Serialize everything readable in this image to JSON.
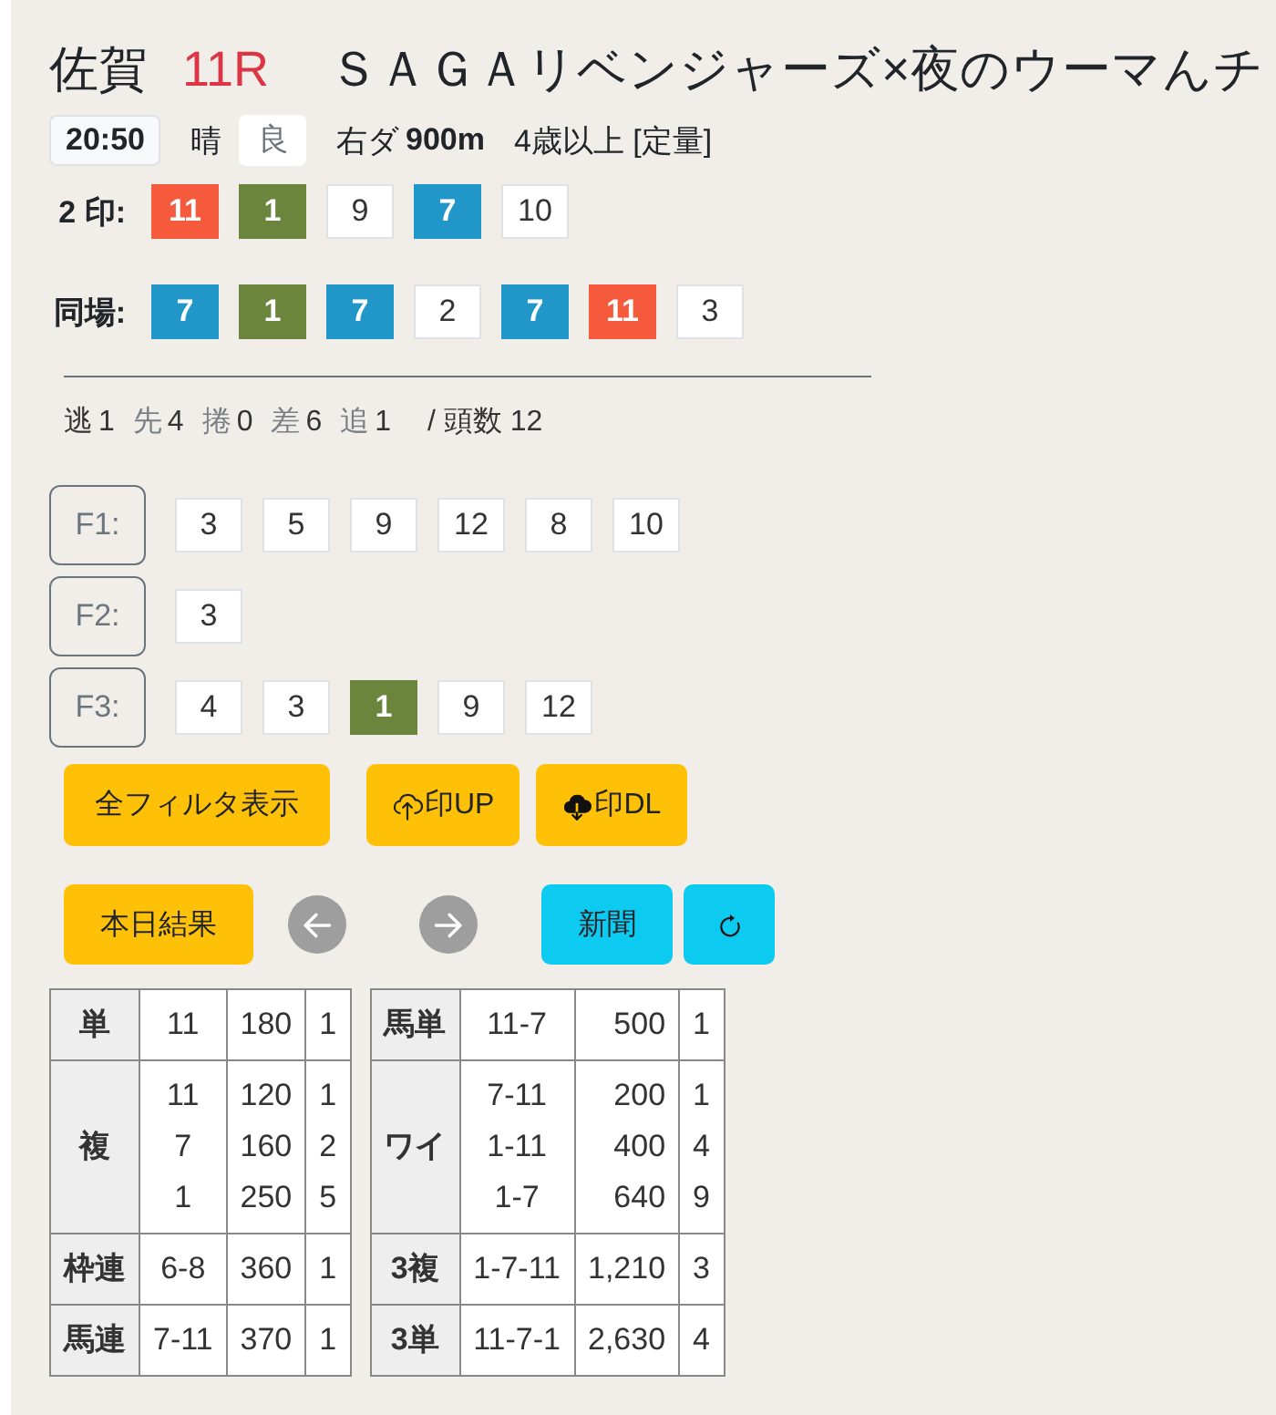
{
  "header": {
    "venue": "佐賀",
    "race_number": "11R",
    "race_name": "ＳＡＧＡリベンジャーズ×夜のウーマんチ"
  },
  "conditions": {
    "post_time": "20:50",
    "weather": "晴",
    "going": "良",
    "course": "右ダ",
    "distance": "900m",
    "race_class": "4歳以上 [定量]"
  },
  "mark_rows": [
    {
      "label": "2 印:",
      "items": [
        {
          "number": "11",
          "color": "#f55a3c"
        },
        {
          "number": "1",
          "color": "#6b853d"
        },
        {
          "number": "9",
          "color": "#ffffff"
        },
        {
          "number": "7",
          "color": "#2196c9"
        },
        {
          "number": "10",
          "color": "#ffffff"
        }
      ]
    },
    {
      "label": "同場:",
      "items": [
        {
          "number": "7",
          "color": "#2196c9"
        },
        {
          "number": "1",
          "color": "#6b853d"
        },
        {
          "number": "7",
          "color": "#2196c9"
        },
        {
          "number": "2",
          "color": "#ffffff"
        },
        {
          "number": "7",
          "color": "#2196c9"
        },
        {
          "number": "11",
          "color": "#f55a3c"
        },
        {
          "number": "3",
          "color": "#ffffff"
        }
      ]
    }
  ],
  "running_styles": {
    "items": [
      {
        "label": "逃",
        "count": "1",
        "active": true
      },
      {
        "label": "先",
        "count": "4",
        "active": false
      },
      {
        "label": "捲",
        "count": "0",
        "active": false
      },
      {
        "label": "差",
        "count": "6",
        "active": false
      },
      {
        "label": "追",
        "count": "1",
        "active": false
      }
    ],
    "field_size": "/ 頭数 12"
  },
  "filters": [
    {
      "label": "F1:",
      "items": [
        {
          "number": "3",
          "color": "#ffffff"
        },
        {
          "number": "5",
          "color": "#ffffff"
        },
        {
          "number": "9",
          "color": "#ffffff"
        },
        {
          "number": "12",
          "color": "#ffffff"
        },
        {
          "number": "8",
          "color": "#ffffff"
        },
        {
          "number": "10",
          "color": "#ffffff"
        }
      ]
    },
    {
      "label": "F2:",
      "items": [
        {
          "number": "3",
          "color": "#ffffff"
        }
      ]
    },
    {
      "label": "F3:",
      "items": [
        {
          "number": "4",
          "color": "#ffffff"
        },
        {
          "number": "3",
          "color": "#ffffff"
        },
        {
          "number": "1",
          "color": "#6b853d"
        },
        {
          "number": "9",
          "color": "#ffffff"
        },
        {
          "number": "12",
          "color": "#ffffff"
        }
      ]
    }
  ],
  "toolbar": [
    {
      "buttons": [
        {
          "kind": "text",
          "label": "全フィルタ表示",
          "color": "#ffc107"
        },
        {
          "kind": "upload",
          "label": "印UP",
          "color": "#ffc107"
        },
        {
          "kind": "download",
          "label": "印DL",
          "color": "#ffc107"
        }
      ]
    },
    {
      "buttons": [
        {
          "kind": "text",
          "label": "本日結果",
          "color": "#ffc107"
        },
        {
          "kind": "previous",
          "color": "#9e9e9e"
        },
        {
          "kind": "next",
          "color": "#9e9e9e"
        },
        {
          "kind": "text",
          "label": "新聞",
          "color": "#0dcaf0"
        },
        {
          "kind": "refresh",
          "color": "#0dcaf0"
        }
      ]
    }
  ],
  "payout_tables": [
    {
      "rows": [
        {
          "bet_type": "単",
          "entries": [
            {
              "combination": "11",
              "payout": "180",
              "popularity": "1"
            }
          ]
        },
        {
          "bet_type": "複",
          "entries": [
            {
              "combination": "11",
              "payout": "120",
              "popularity": "1"
            },
            {
              "combination": "7",
              "payout": "160",
              "popularity": "2"
            },
            {
              "combination": "1",
              "payout": "250",
              "popularity": "5"
            }
          ]
        },
        {
          "bet_type": "枠連",
          "entries": [
            {
              "combination": "6-8",
              "payout": "360",
              "popularity": "1"
            }
          ]
        },
        {
          "bet_type": "馬連",
          "entries": [
            {
              "combination": "7-11",
              "payout": "370",
              "popularity": "1"
            }
          ]
        }
      ]
    },
    {
      "rows": [
        {
          "bet_type": "馬単",
          "entries": [
            {
              "combination": "11-7",
              "payout": "500",
              "popularity": "1"
            }
          ]
        },
        {
          "bet_type": "ワイ",
          "entries": [
            {
              "combination": "7-11",
              "payout": "200",
              "popularity": "1"
            },
            {
              "combination": "1-11",
              "payout": "400",
              "popularity": "4"
            },
            {
              "combination": "1-7",
              "payout": "640",
              "popularity": "9"
            }
          ]
        },
        {
          "bet_type": "3複",
          "entries": [
            {
              "combination": "1-7-11",
              "payout": "1,210",
              "popularity": "3"
            }
          ]
        },
        {
          "bet_type": "3単",
          "entries": [
            {
              "combination": "11-7-1",
              "payout": "2,630",
              "popularity": "4"
            }
          ]
        }
      ]
    }
  ]
}
